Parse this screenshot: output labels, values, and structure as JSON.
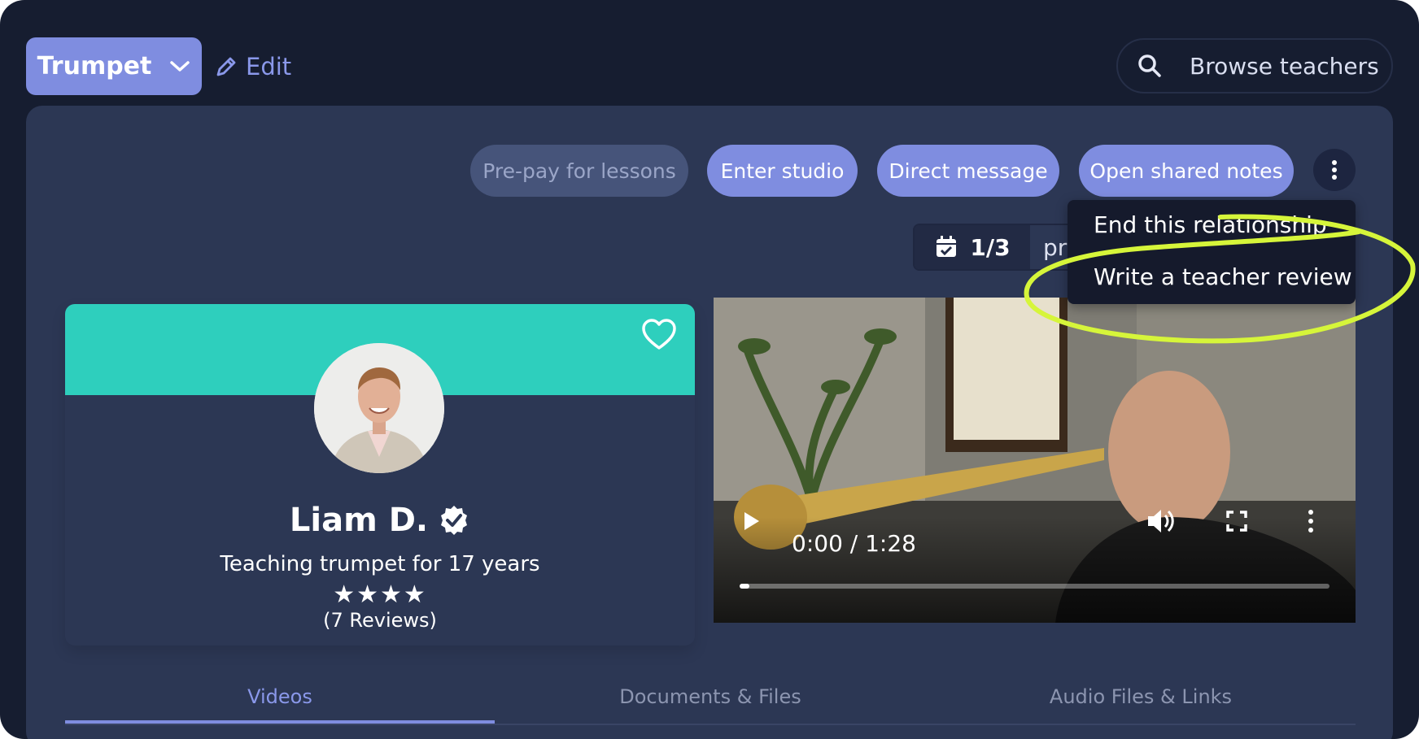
{
  "header": {
    "instrument": "Trumpet",
    "edit_label": "Edit",
    "search_label": "Browse teachers"
  },
  "actions": {
    "prepay": "Pre-pay for lessons",
    "enter_studio": "Enter studio",
    "direct_message": "Direct message",
    "shared_notes": "Open shared notes"
  },
  "lessons": {
    "count": "1/3",
    "trailing_text": "pr"
  },
  "menu": {
    "items": [
      "End this relationship",
      "Write a teacher review"
    ]
  },
  "teacher": {
    "name": "Liam D.",
    "tagline": "Teaching trumpet for 17 years",
    "stars": "★★★★",
    "rating": 4,
    "reviews": "(7 Reviews)"
  },
  "video": {
    "time": "0:00 / 1:28"
  },
  "tabs": [
    "Videos",
    "Documents & Files",
    "Audio Files & Links"
  ],
  "colors": {
    "accent": "#7f8de0",
    "banner": "#2ecfbd",
    "highlight": "#d6f53a",
    "background": "#161d30",
    "panel": "#2c3754"
  }
}
